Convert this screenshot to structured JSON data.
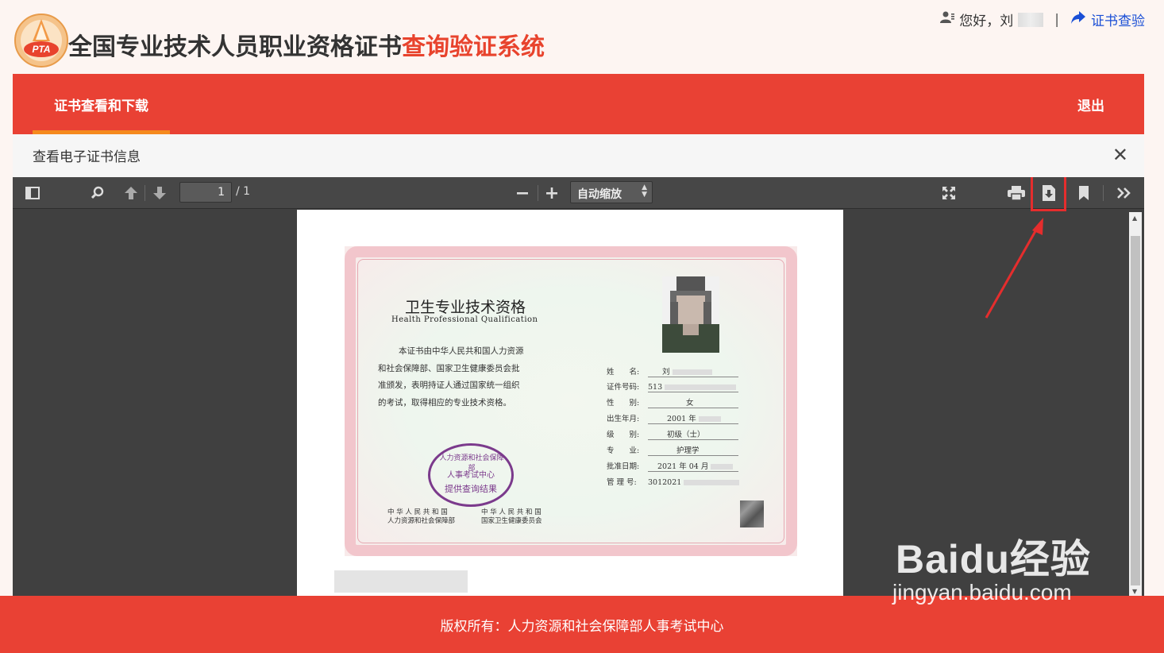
{
  "header": {
    "logo_text": "PTA",
    "title_main": "全国专业技术人员职业资格证书",
    "title_accent": "查询验证系统",
    "greeting": "您好，刘",
    "separator": "|",
    "verify_link": "证书查验"
  },
  "nav": {
    "tab_active": "证书查看和下载",
    "logout": "退出"
  },
  "panel": {
    "title": "查看电子证书信息",
    "close": "✕"
  },
  "viewer": {
    "page_current": "1",
    "page_total": "/ 1",
    "zoom": "自动缩放"
  },
  "certificate": {
    "title_cn": "卫生专业技术资格",
    "title_en": "Health Professional Qualification",
    "body_lines": [
      "本证书由中华人民共和国人力资源",
      "和社会保障部、国家卫生健康委员会批",
      "准颁发，表明持证人通过国家统一组织",
      "的考试，取得相应的专业技术资格。"
    ],
    "fields": [
      {
        "label": "姓　　名:",
        "value": "刘"
      },
      {
        "label": "证件号码:",
        "value": "513"
      },
      {
        "label": "性　　别:",
        "value": "女"
      },
      {
        "label": "出生年月:",
        "value": "2001 年"
      },
      {
        "label": "级　　别:",
        "value": "初级（士）"
      },
      {
        "label": "专　　业:",
        "value": "护理学"
      },
      {
        "label": "批准日期:",
        "value": "2021 年 04 月"
      },
      {
        "label": "管 理 号:",
        "value": "3012021"
      }
    ],
    "stamp": {
      "ring": "人力资源和社会保障部",
      "center": "人事考试中心",
      "bottom": "提供查询结果"
    },
    "issuer_left": [
      "中 华 人 民 共 和 国",
      "人力资源和社会保障部"
    ],
    "issuer_right": [
      "中 华 人 民 共 和 国",
      "国家卫生健康委员会"
    ]
  },
  "footer": {
    "copyright": "版权所有：人力资源和社会保障部人事考试中心"
  },
  "watermark": {
    "brand": "Baidu经验",
    "url": "jingyan.baidu.com"
  }
}
